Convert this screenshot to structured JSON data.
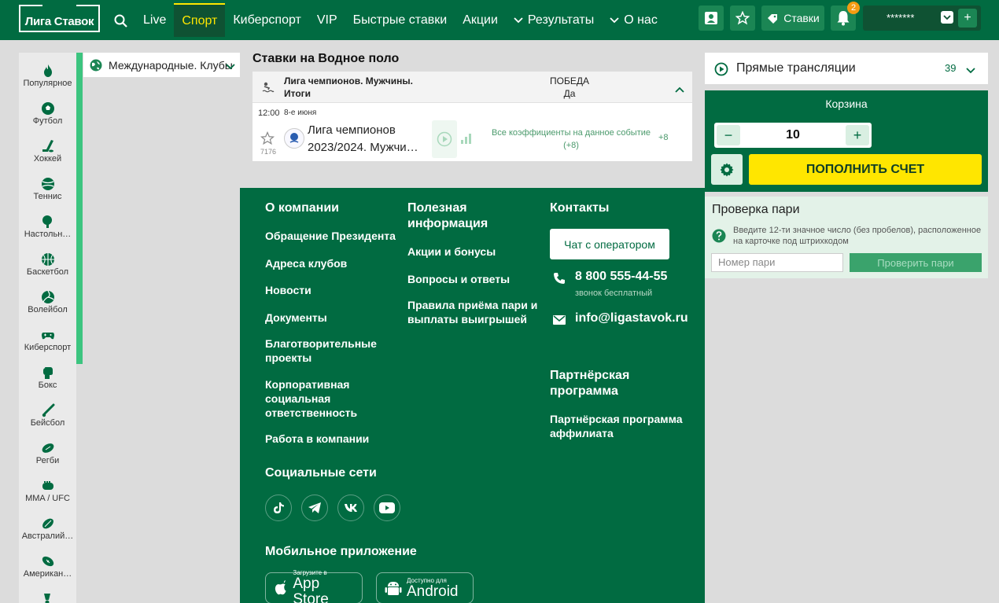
{
  "header": {
    "logo_text": "Лига Ставок",
    "nav": [
      "Live",
      "Спорт",
      "Киберспорт",
      "VIP",
      "Быстрые ставки",
      "Акции",
      "Результаты",
      "О нас"
    ],
    "active_nav": "Спорт",
    "bets_label": "Ставки",
    "notifications_count": "2",
    "user_masked": "*******",
    "plus_label": "+"
  },
  "sports": [
    {
      "label": "Популярное",
      "icon": "flame-icon"
    },
    {
      "label": "Футбол",
      "icon": "football-icon"
    },
    {
      "label": "Хоккей",
      "icon": "hockey-icon"
    },
    {
      "label": "Теннис",
      "icon": "tennis-icon"
    },
    {
      "label": "Настольн…",
      "icon": "table-tennis-icon"
    },
    {
      "label": "Баскетбол",
      "icon": "basketball-icon"
    },
    {
      "label": "Волейбол",
      "icon": "volleyball-icon"
    },
    {
      "label": "Киберспорт",
      "icon": "gamepad-icon"
    },
    {
      "label": "Бокс",
      "icon": "boxing-icon"
    },
    {
      "label": "Бейсбол",
      "icon": "baseball-icon"
    },
    {
      "label": "Регби",
      "icon": "rugby-icon"
    },
    {
      "label": "MMA / UFC",
      "icon": "mma-icon"
    },
    {
      "label": "Австралий…",
      "icon": "aussie-football-icon"
    },
    {
      "label": "Американ…",
      "icon": "american-football-icon"
    },
    {
      "label": "",
      "icon": "badminton-icon"
    }
  ],
  "category": {
    "label": "Международные. Клубы"
  },
  "main": {
    "title": "Ставки на Водное поло",
    "event_header": {
      "league_line1": "Лига чемпионов. Мужчины.",
      "league_line2": "Итоги",
      "market_line1": "ПОБЕДА",
      "market_line2": "Да"
    },
    "event": {
      "time": "12:00",
      "date": "8-е июня",
      "id": "7176",
      "name_line1": "Лига чемпионов",
      "name_line2": "2023/2024. Мужчин…",
      "all_odds_line1": "Все коэффициенты на данное событие",
      "all_odds_line2": "(+8)",
      "plus_count": "+8"
    }
  },
  "footer": {
    "col1": {
      "title": "О компании",
      "links": [
        "Обращение Президента",
        "Адреса клубов",
        "Новости",
        "Документы",
        "Благотворительные проекты",
        "Корпоративная социальная ответственность",
        "Работа в компании"
      ]
    },
    "col2": {
      "title": "Полезная информация",
      "links": [
        "Акции и бонусы",
        "Вопросы и ответы",
        "Правила приёма пари и выплаты выигрышей"
      ]
    },
    "col3": {
      "title": "Контакты",
      "chat_button": "Чат с оператором",
      "phone": "8 800 555-44-55",
      "phone_note": "звонок бесплатный",
      "email": "info@ligastavok.ru",
      "partner_title": "Партнёрская программа",
      "partner_link": "Партнёрская программа аффилиата"
    },
    "social_title": "Социальные сети",
    "mobile_title": "Мобильное приложение",
    "appstore_small": "Загрузите в",
    "appstore_big": "App Store",
    "android_small": "Доступно для",
    "android_big": "Android"
  },
  "right": {
    "live_label": "Прямые трансляции",
    "live_count": "39",
    "basket_title": "Корзина",
    "stake_value": "10",
    "stake_minus": "−",
    "stake_plus": "+",
    "deposit_label": "ПОПОЛНИТЬ СЧЕТ",
    "check_title": "Проверка пари",
    "check_hint": "Введите 12-ти значное число (без пробелов), расположенное на карточке под штрихкодом",
    "check_placeholder": "Номер пари",
    "check_button": "Проверить пари"
  },
  "colors": {
    "brand": "#016b41",
    "accent": "#ffe600",
    "light": "#e3f2e8"
  }
}
